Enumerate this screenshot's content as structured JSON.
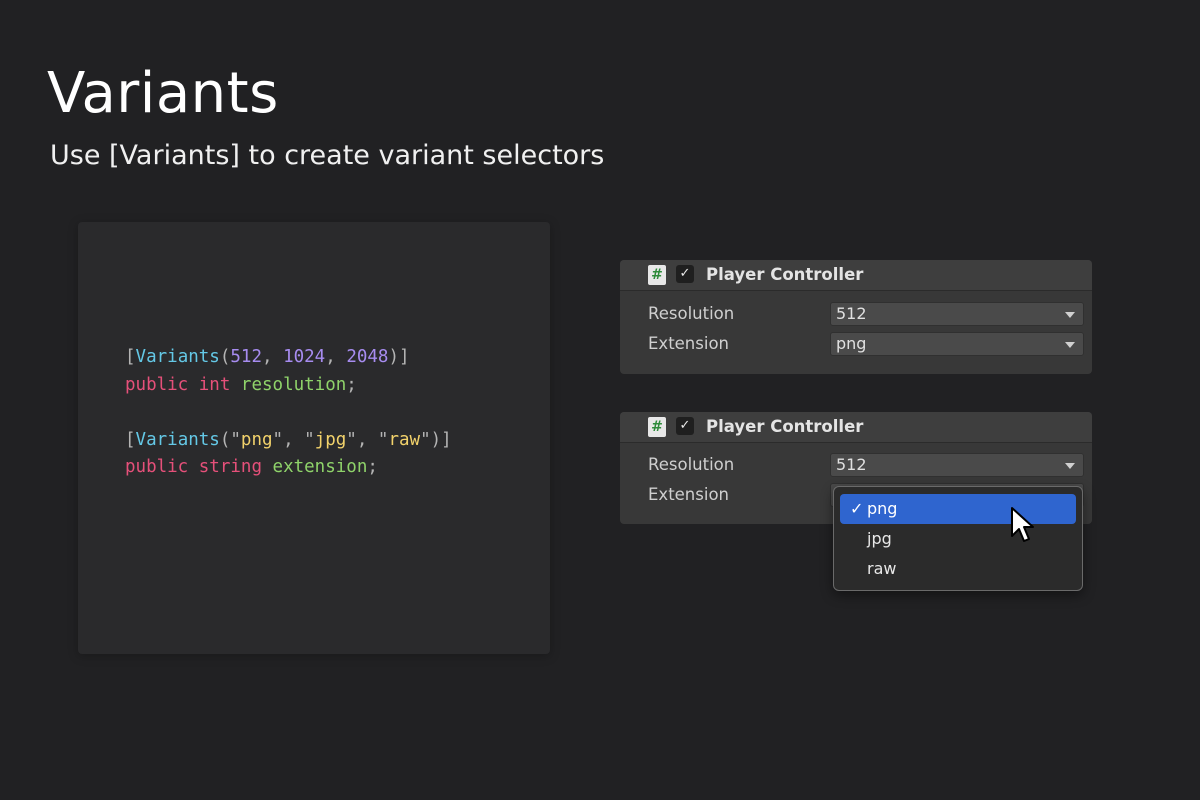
{
  "header": {
    "title": "Variants",
    "subtitle": "Use [Variants] to create variant selectors"
  },
  "code": {
    "lines": [
      [
        {
          "t": "[",
          "c": "bracket"
        },
        {
          "t": "Variants",
          "c": "attr"
        },
        {
          "t": "(",
          "c": "punc"
        },
        {
          "t": "512",
          "c": "num"
        },
        {
          "t": ", ",
          "c": "punc"
        },
        {
          "t": "1024",
          "c": "num"
        },
        {
          "t": ", ",
          "c": "punc"
        },
        {
          "t": "2048",
          "c": "num"
        },
        {
          "t": ")]",
          "c": "punc"
        }
      ],
      [
        {
          "t": "public",
          "c": "kw"
        },
        {
          "t": " ",
          "c": "punc"
        },
        {
          "t": "int",
          "c": "kw"
        },
        {
          "t": " ",
          "c": "punc"
        },
        {
          "t": "resolution",
          "c": "ident"
        },
        {
          "t": ";",
          "c": "punc"
        }
      ],
      [],
      [
        {
          "t": "[",
          "c": "bracket"
        },
        {
          "t": "Variants",
          "c": "attr"
        },
        {
          "t": "(\"",
          "c": "punc"
        },
        {
          "t": "png",
          "c": "str"
        },
        {
          "t": "\", \"",
          "c": "punc"
        },
        {
          "t": "jpg",
          "c": "str"
        },
        {
          "t": "\", \"",
          "c": "punc"
        },
        {
          "t": "raw",
          "c": "str"
        },
        {
          "t": "\")]",
          "c": "punc"
        }
      ],
      [
        {
          "t": "public",
          "c": "kw"
        },
        {
          "t": " ",
          "c": "punc"
        },
        {
          "t": "string",
          "c": "kw"
        },
        {
          "t": " ",
          "c": "punc"
        },
        {
          "t": "extension",
          "c": "ident"
        },
        {
          "t": ";",
          "c": "punc"
        }
      ]
    ]
  },
  "panel1": {
    "script_icon": "#",
    "checkbox": "✓",
    "title": "Player Controller",
    "resolution_label": "Resolution",
    "resolution_value": "512",
    "extension_label": "Extension",
    "extension_value": "png"
  },
  "panel2": {
    "script_icon": "#",
    "checkbox": "✓",
    "title": "Player Controller",
    "resolution_label": "Resolution",
    "resolution_value": "512",
    "extension_label": "Extension"
  },
  "menu": {
    "check_mark": "✓",
    "items": [
      "png",
      "jpg",
      "raw"
    ],
    "selected": "png"
  },
  "colors": {
    "background": "#212123",
    "selection": "#2f65cf",
    "keyword": "#e6507a",
    "attribute": "#64c8e6",
    "number": "#a78cf0",
    "string": "#f2d26b",
    "identifier": "#8fd36a"
  },
  "icons": {
    "script": "csharp-script-icon",
    "checkbox": "checkbox-checked-icon",
    "dropdown": "chevron-down-icon",
    "cursor": "mouse-pointer-icon"
  }
}
